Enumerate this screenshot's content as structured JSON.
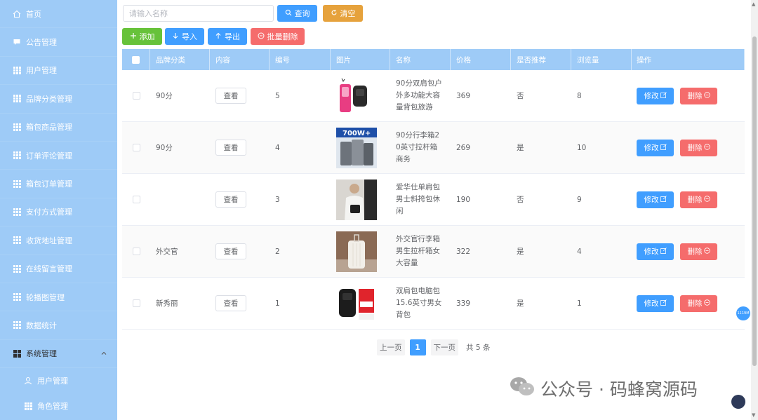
{
  "sidebar": {
    "items": [
      {
        "label": "首页",
        "icon": "home-icon"
      },
      {
        "label": "公告管理",
        "icon": "message-icon"
      },
      {
        "label": "用户管理",
        "icon": "grid-icon"
      },
      {
        "label": "品牌分类管理",
        "icon": "grid-icon"
      },
      {
        "label": "箱包商品管理",
        "icon": "grid-icon"
      },
      {
        "label": "订单评论管理",
        "icon": "grid-icon"
      },
      {
        "label": "箱包订单管理",
        "icon": "grid-icon"
      },
      {
        "label": "支付方式管理",
        "icon": "grid-icon"
      },
      {
        "label": "收货地址管理",
        "icon": "grid-icon"
      },
      {
        "label": "在线留言管理",
        "icon": "grid-icon"
      },
      {
        "label": "轮播图管理",
        "icon": "grid-icon"
      },
      {
        "label": "数据统计",
        "icon": "grid-icon"
      }
    ],
    "system": {
      "label": "系统管理",
      "icon": "grid-icon",
      "expanded": true
    },
    "sub_items": [
      {
        "label": "用户管理",
        "icon": "user-icon"
      },
      {
        "label": "角色管理",
        "icon": "grid-icon"
      }
    ]
  },
  "search": {
    "placeholder": "请输入名称",
    "query_label": "查询",
    "clear_label": "清空"
  },
  "toolbar": {
    "add_label": "添加",
    "import_label": "导入",
    "export_label": "导出",
    "batch_delete_label": "批量删除"
  },
  "table": {
    "headers": [
      "品牌分类",
      "内容",
      "编号",
      "图片",
      "名称",
      "价格",
      "是否推荐",
      "浏览量",
      "操作"
    ],
    "view_label": "查看",
    "edit_label": "修改",
    "delete_label": "删除",
    "rows": [
      {
        "category": "90分",
        "no": "5",
        "name": "90分双肩包户外多功能大容量背包旅游",
        "price": "369",
        "recommend": "否",
        "views": "8",
        "image": "backpack-pink-black"
      },
      {
        "category": "90分",
        "no": "4",
        "name": "90分行李箱20英寸拉杆箱商务",
        "price": "269",
        "recommend": "是",
        "views": "10",
        "image": "suitcase-gray-700w",
        "image_text": "700W+"
      },
      {
        "category": "",
        "no": "3",
        "name": "爱华仕单肩包男士斜挎包休闲",
        "price": "190",
        "recommend": "否",
        "views": "9",
        "image": "shoulder-bag-model"
      },
      {
        "category": "外交官",
        "no": "2",
        "name": "外交官行李箱男生拉杆箱女大容量",
        "price": "322",
        "recommend": "是",
        "views": "4",
        "image": "suitcase-white"
      },
      {
        "category": "新秀丽",
        "no": "1",
        "name": "双肩包电脑包15.6英寸男女背包",
        "price": "339",
        "recommend": "是",
        "views": "1",
        "image": "laptop-backpack-black"
      }
    ]
  },
  "pagination": {
    "prev_label": "上一页",
    "current_page": "1",
    "next_label": "下一页",
    "total_text": "共 5 条"
  },
  "float_badge": "1119M",
  "watermark": "公众号 · 码蜂窝源码",
  "colors": {
    "sidebar": "#9ecbf7",
    "primary": "#409eff",
    "warning": "#e6a23c",
    "success": "#67c23a",
    "danger": "#f56c6c"
  }
}
